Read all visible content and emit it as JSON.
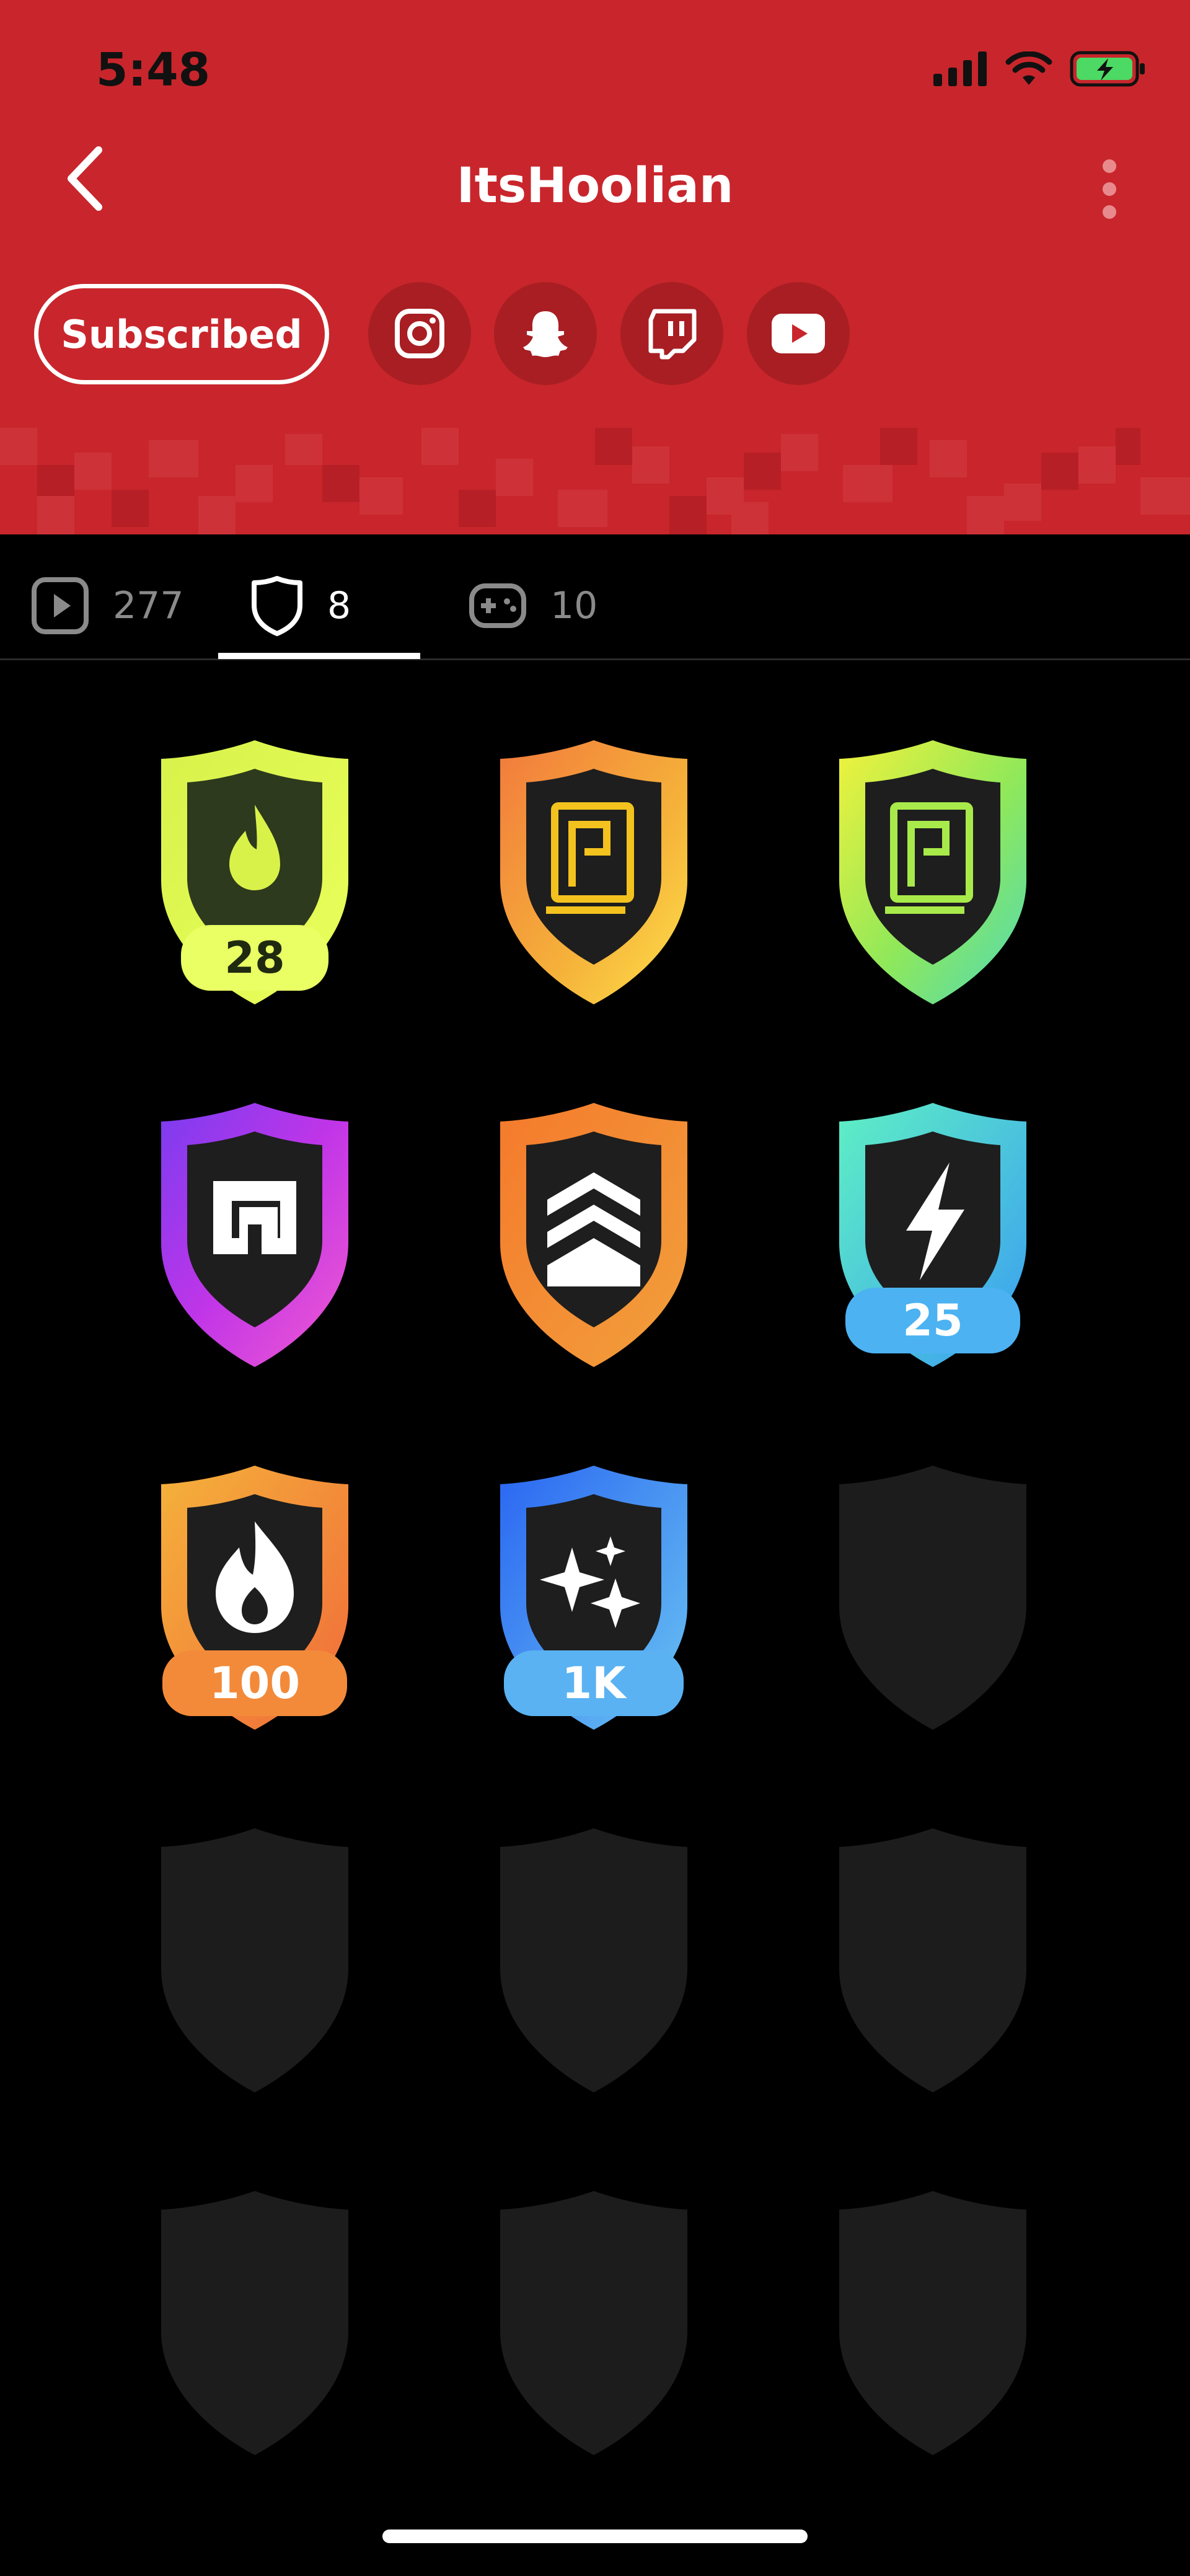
{
  "status_bar": {
    "time": "5:48"
  },
  "header": {
    "title": "ItsHoolian",
    "subscribe_label": "Subscribed",
    "social": [
      {
        "icon": "instagram-icon"
      },
      {
        "icon": "snapchat-icon"
      },
      {
        "icon": "twitch-icon"
      },
      {
        "icon": "youtube-icon"
      }
    ]
  },
  "tabs": [
    {
      "icon": "play-icon",
      "count": "277",
      "active": false
    },
    {
      "icon": "shield-icon",
      "count": "8",
      "active": true
    },
    {
      "icon": "gamepad-icon",
      "count": "10",
      "active": false
    }
  ],
  "badges": [
    {
      "icon": "flame-icon",
      "label": "28",
      "theme": "lime"
    },
    {
      "icon": "page-icon",
      "label": "",
      "theme": "orange-yellow"
    },
    {
      "icon": "page-icon",
      "label": "",
      "theme": "lime-teal"
    },
    {
      "icon": "logo-icon",
      "label": "",
      "theme": "purple"
    },
    {
      "icon": "chevrons-icon",
      "label": "",
      "theme": "orange"
    },
    {
      "icon": "bolt-icon",
      "label": "25",
      "theme": "teal-blue"
    },
    {
      "icon": "fire-icon",
      "label": "100",
      "theme": "amber"
    },
    {
      "icon": "sparkles-icon",
      "label": "1K",
      "theme": "blue"
    }
  ],
  "locked_badge_count": 7,
  "colors": {
    "header_red": "#c8262c",
    "background": "#000000",
    "locked_badge": "#1c1c1c"
  }
}
